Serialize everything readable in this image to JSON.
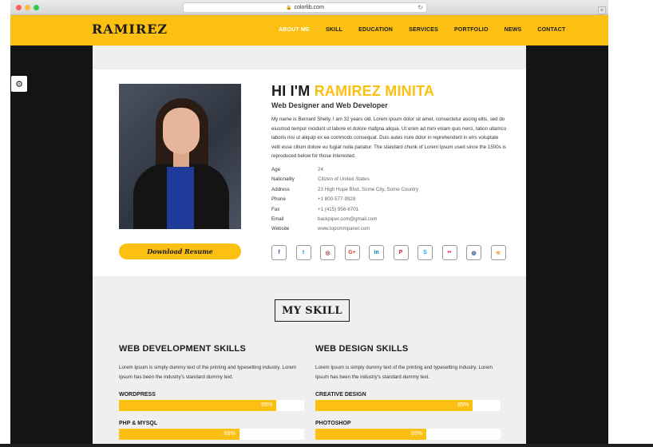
{
  "browser": {
    "url": "colorlib.com"
  },
  "site": {
    "logo": "RAMIREZ",
    "nav": [
      "ABOUT ME",
      "SKILL",
      "EDUCATION",
      "SERVICES",
      "PORTFOLIO",
      "NEWS",
      "CONTACT"
    ],
    "active_nav": "ABOUT ME"
  },
  "about": {
    "greeting": "HI I'M",
    "name": "RAMIREZ MINITA",
    "role": "Web Designer and Web Developer",
    "bio": "My name is Bernard Shelly. I am 32 years old. Lorem ipsum dolor sit amet, consectetur ascing elits, sed do eiusmod tempor incidunt ut labore et dolore mafgna aliqua. Ut enim ad mini vniam quis nerci, tation ullamco laboris nisi ut aliquip ex ea commodo consequat. Duis autes irure dolor in reprehenderit in etrs voluptate velit esse cillum dolore eu fugiat nulla pariatur. The standard chunk of Lorem Ipsum used since the 1500s is reproduced below for those interested.",
    "info": [
      {
        "label": "Age",
        "value": "24"
      },
      {
        "label": "Nationality",
        "value": "Citizen of United States"
      },
      {
        "label": "Address",
        "value": "23 High Hope Blvd, Some City, Some Country"
      },
      {
        "label": "Phone",
        "value": "+1 800-577-9928"
      },
      {
        "label": "Fax",
        "value": "+1 (415) 956-6701"
      },
      {
        "label": "Email",
        "value": "backpiper.com@gmail.com"
      },
      {
        "label": "Website",
        "value": "www.topsmmpanel.com"
      }
    ],
    "download_label": "Download Resume",
    "socials": [
      {
        "icon": "facebook-icon",
        "glyph": "f",
        "color": "#3b5998"
      },
      {
        "icon": "twitter-icon",
        "glyph": "t",
        "color": "#1da1f2"
      },
      {
        "icon": "instagram-icon",
        "glyph": "◎",
        "color": "#8a3a3a"
      },
      {
        "icon": "google-plus-icon",
        "glyph": "G+",
        "color": "#dd4b39"
      },
      {
        "icon": "linkedin-icon",
        "glyph": "in",
        "color": "#0077b5"
      },
      {
        "icon": "pinterest-icon",
        "glyph": "P",
        "color": "#cb2027"
      },
      {
        "icon": "skype-icon",
        "glyph": "S",
        "color": "#00aff0"
      },
      {
        "icon": "flickr-icon",
        "glyph": "••",
        "color": "#ff0084"
      },
      {
        "icon": "dribbble-icon",
        "glyph": "◍",
        "color": "#3f6b9a"
      },
      {
        "icon": "rss-icon",
        "glyph": "≋",
        "color": "#f59a2c"
      }
    ]
  },
  "skills": {
    "heading": "MY SKILL",
    "web_dev": {
      "title": "WEB DEVELOPMENT SKILLS",
      "text": "Lorem Ipsum is simply dummy text of the printing and typesetting industry. Lorem Ipsum has been the industry's standard dummy text.",
      "items": [
        {
          "name": "WORDPRESS",
          "percent": 85,
          "label": "85%"
        },
        {
          "name": "PHP & MYSQL",
          "percent": 65,
          "label": "65%"
        }
      ]
    },
    "web_design": {
      "title": "WEB DESIGN SKILLS",
      "text": "Lorem Ipsum is simply dummy text of the printing and typesetting industry. Lorem Ipsum has been the industry's standard dummy text.",
      "items": [
        {
          "name": "CREATIVE DESIGN",
          "percent": 85,
          "label": "85%"
        },
        {
          "name": "PHOTOSHOP",
          "percent": 60,
          "label": "65%"
        }
      ]
    }
  },
  "colors": {
    "accent": "#fcc013",
    "dark": "#1b1b1b"
  }
}
